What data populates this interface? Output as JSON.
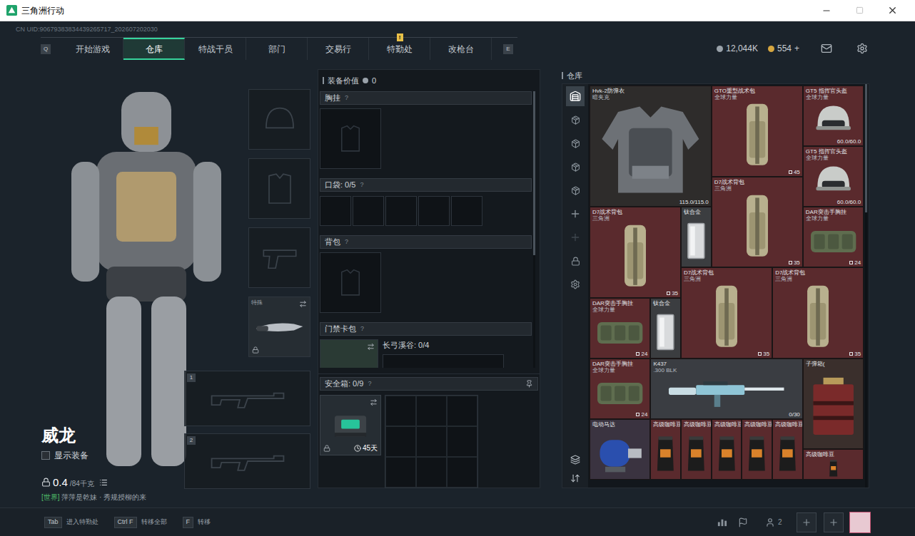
{
  "window": {
    "title": "三角洲行动"
  },
  "uid": "CN UID:90679383834439265717_202607202030",
  "nav": {
    "left_key": "Q",
    "right_key": "E",
    "tabs": [
      {
        "label": "开始游戏",
        "selected": false
      },
      {
        "label": "仓库",
        "selected": true
      },
      {
        "label": "特战干员",
        "selected": false
      },
      {
        "label": "部门",
        "selected": false
      },
      {
        "label": "交易行",
        "selected": false
      },
      {
        "label": "特勤处",
        "selected": false,
        "badge": "!"
      },
      {
        "label": "改枪台",
        "selected": false
      }
    ]
  },
  "currency": [
    {
      "kind": "coin",
      "amount": "12,044K"
    },
    {
      "kind": "gold",
      "amount": "554",
      "action": "+"
    }
  ],
  "character": {
    "name": "威龙",
    "show_equipment": {
      "label": "显示装备",
      "checked": false
    },
    "weight": "0.4",
    "weight_max": "/84千克"
  },
  "chat": {
    "channel": "[世界]",
    "text": "萍萍是乾妹 · 秀规授柳的来"
  },
  "equip_slots": [
    {
      "kind": "helmet",
      "equipped": false,
      "locked": false
    },
    {
      "kind": "armor",
      "equipped": false,
      "locked": false
    },
    {
      "kind": "pistol",
      "equipped": false,
      "locked": false
    },
    {
      "kind": "melee",
      "label": "特殊",
      "equipped": true,
      "locked": true
    }
  ],
  "weapon_slots": [
    {
      "key": "1",
      "equipped": false
    },
    {
      "key": "2",
      "equipped": false
    }
  ],
  "loadout": {
    "value_label": "装备价值",
    "value": "0",
    "help": "?",
    "sections": [
      {
        "kind": "single",
        "label": "胸挂",
        "equipped": false
      },
      {
        "kind": "pockets",
        "label": "口袋: 0/5",
        "pockets": [
          {
            "filled": false
          },
          {
            "filled": false
          },
          {
            "filled": false
          },
          {
            "filled": false
          },
          {
            "filled": false
          }
        ]
      },
      {
        "kind": "single",
        "label": "背包",
        "equipped": false
      },
      {
        "kind": "keycard",
        "label": "门禁卡包",
        "map": "长弓溪谷: 0/4"
      }
    ]
  },
  "safebox": {
    "label": "安全箱: 0/9",
    "duration": "45天",
    "locked": true,
    "cells": [
      {
        "filled": false
      },
      {
        "filled": false
      },
      {
        "filled": false
      },
      {
        "filled": false
      },
      {
        "filled": false
      },
      {
        "filled": false
      },
      {
        "filled": false
      },
      {
        "filled": false
      },
      {
        "filled": false
      }
    ]
  },
  "stash": {
    "title": "仓库",
    "sidebar": [
      {
        "kind": "warehouse",
        "selected": true,
        "disabled": false
      },
      {
        "kind": "sub",
        "selected": false,
        "disabled": false
      },
      {
        "kind": "sub",
        "selected": false,
        "disabled": false
      },
      {
        "kind": "sub",
        "selected": false,
        "disabled": false
      },
      {
        "kind": "sub",
        "selected": false,
        "disabled": false
      },
      {
        "kind": "add",
        "selected": false,
        "disabled": false
      },
      {
        "kind": "add",
        "selected": false,
        "disabled": true
      },
      {
        "kind": "lock",
        "selected": false,
        "disabled": false
      },
      {
        "kind": "settings",
        "selected": false,
        "disabled": false
      }
    ],
    "tools": [
      {
        "kind": "layers"
      },
      {
        "kind": "sort"
      }
    ],
    "items": [
      {
        "name": "Hvk-2防弹衣",
        "sub": "暗夹克",
        "reading": "115.0/115.0",
        "kind": "armor",
        "color": "#2e2c2b"
      },
      {
        "name": "GTO重型战术包",
        "sub": "全球力量",
        "tag": "45",
        "kind": "backpack",
        "color": "#5a2a2d"
      },
      {
        "name": "GT5 指挥官头盔",
        "sub": "全球力量",
        "reading": "60.0/60.0",
        "kind": "helmet",
        "color": "#5a2a2d"
      },
      {
        "name": "GT5 指挥官头盔",
        "sub": "全球力量",
        "reading": "60.0/60.0",
        "kind": "helmet",
        "color": "#5a2a2d"
      },
      {
        "name": "D7战术背包",
        "sub": "三角洲",
        "tag": "35",
        "kind": "backpack",
        "color": "#5a2a2d"
      },
      {
        "name": "D7战术背包",
        "sub": "三角洲",
        "tag": "35",
        "kind": "backpack",
        "color": "#5a2a2d"
      },
      {
        "name": "钛合金",
        "kind": "plate",
        "color": "#3b3d40"
      },
      {
        "name": "DAR突击手胸挂",
        "sub": "全球力量",
        "tag": "24",
        "kind": "chestrig",
        "color": "#5a2a2d"
      },
      {
        "name": "D7战术背包",
        "sub": "三角洲",
        "tag": "35",
        "kind": "backpack",
        "color": "#5a2a2d"
      },
      {
        "name": "D7战术背包",
        "sub": "三角洲",
        "tag": "35",
        "kind": "backpack",
        "color": "#5a2a2d"
      },
      {
        "name": "DAR突击手胸挂",
        "sub": "全球力量",
        "tag": "24",
        "kind": "chestrig",
        "color": "#5a2a2d"
      },
      {
        "name": "钛合金",
        "kind": "plate",
        "color": "#3b3d40"
      },
      {
        "name": "DAR突击手胸挂",
        "sub": "全球力量",
        "tag": "24",
        "kind": "chestrig",
        "color": "#5a2a2d"
      },
      {
        "name": "K437",
        "sub": ".300 BLK",
        "reading": "0/30",
        "kind": "rifle",
        "color": "#3a3d42"
      },
      {
        "name": "子弹箱(",
        "kind": "box",
        "color": "#3a2f2c"
      },
      {
        "name": "电动马达",
        "kind": "motor",
        "color": "#3a3340"
      },
      {
        "name": "高级咖啡豆",
        "kind": "coffee",
        "color": "#5a2a2d"
      },
      {
        "name": "高级咖啡豆",
        "kind": "coffee",
        "color": "#5a2a2d"
      },
      {
        "name": "高级咖啡豆",
        "kind": "coffee",
        "color": "#5a2a2d"
      },
      {
        "name": "高级咖啡豆",
        "kind": "coffee",
        "color": "#5a2a2d"
      },
      {
        "name": "高级咖啡豆",
        "kind": "coffee",
        "color": "#5a2a2d"
      },
      {
        "name": "高级咖啡豆",
        "kind": "coffee",
        "color": "#5a2a2d"
      }
    ]
  },
  "bottom_bar": {
    "hints": [
      {
        "key": "Tab",
        "label": "进入特勤处"
      },
      {
        "key": "Ctrl F",
        "label": "转移全部"
      },
      {
        "key": "F",
        "label": "转移"
      }
    ],
    "friends": "2"
  }
}
